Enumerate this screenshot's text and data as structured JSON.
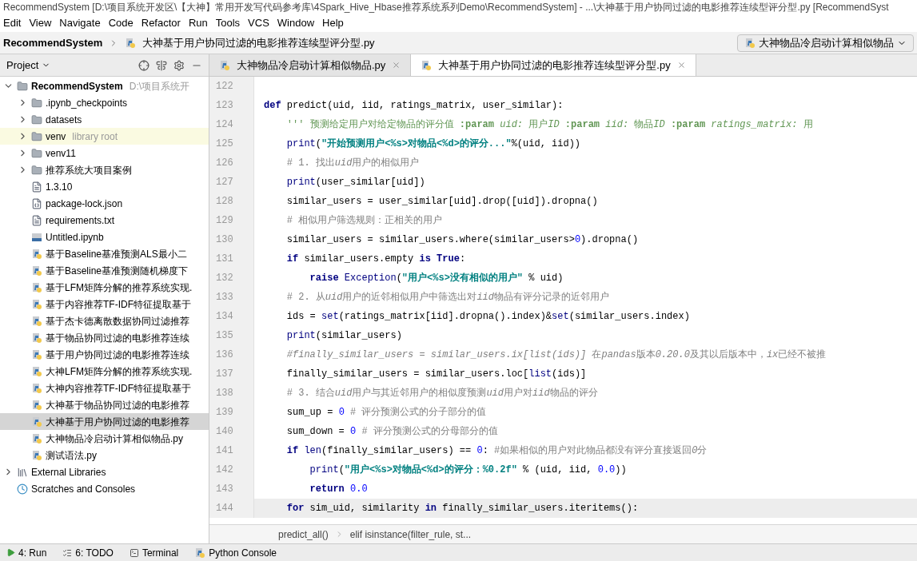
{
  "window": {
    "title": "RecommendSystem [D:\\项目系统开发区\\【大神】常用开发写代码参考库\\4Spark_Hive_Hbase推荐系统系列Demo\\RecommendSystem] - ...\\大神基于用户协同过滤的电影推荐连续型评分型.py [RecommendSyst"
  },
  "menu": [
    "Edit",
    "View",
    "Navigate",
    "Code",
    "Refactor",
    "Run",
    "Tools",
    "VCS",
    "Window",
    "Help"
  ],
  "navbar": {
    "project": "RecommendSystem",
    "file": "大神基于用户协同过滤的电影推荐连续型评分型.py",
    "run_config": "大神物品冷启动计算相似物品"
  },
  "project_panel": {
    "title": "Project",
    "tree": [
      {
        "label": "RecommendSystem",
        "hint": "D:\\项目系统开",
        "kind": "folder",
        "expanded": true,
        "selected": false,
        "children": [
          {
            "label": ".ipynb_checkpoints",
            "kind": "folder",
            "expanded": false,
            "selected": false
          },
          {
            "label": "datasets",
            "kind": "folder",
            "expanded": false,
            "selected": false
          },
          {
            "label": "venv",
            "hint": "library root",
            "kind": "folder",
            "expanded": false,
            "selected": false
          },
          {
            "label": "venv11",
            "kind": "folder",
            "expanded": false,
            "selected": false
          },
          {
            "label": "推荐系统大项目案例",
            "kind": "folder",
            "expanded": false,
            "selected": false
          },
          {
            "label": "1.3.10",
            "kind": "text",
            "selected": false
          },
          {
            "label": "package-lock.json",
            "kind": "json",
            "selected": false
          },
          {
            "label": "requirements.txt",
            "kind": "text",
            "selected": false
          },
          {
            "label": "Untitled.ipynb",
            "kind": "ipynb",
            "selected": false
          },
          {
            "label": "基于Baseline基准预测ALS最小二",
            "kind": "python",
            "selected": false
          },
          {
            "label": "基于Baseline基准预测随机梯度下",
            "kind": "python",
            "selected": false
          },
          {
            "label": "基于LFM矩阵分解的推荐系统实现.",
            "kind": "python",
            "selected": false
          },
          {
            "label": "基于内容推荐TF-IDF特征提取基于",
            "kind": "python",
            "selected": false
          },
          {
            "label": "基于杰卡德离散数据协同过滤推荐",
            "kind": "python",
            "selected": false
          },
          {
            "label": "基于物品协同过滤的电影推荐连续",
            "kind": "python",
            "selected": false
          },
          {
            "label": "基于用户协同过滤的电影推荐连续",
            "kind": "python",
            "selected": false
          },
          {
            "label": "大神LFM矩阵分解的推荐系统实现.",
            "kind": "python",
            "selected": false
          },
          {
            "label": "大神内容推荐TF-IDF特征提取基于",
            "kind": "python",
            "selected": false
          },
          {
            "label": "大神基于物品协同过滤的电影推荐",
            "kind": "python",
            "selected": false
          },
          {
            "label": "大神基于用户协同过滤的电影推荐",
            "kind": "python",
            "selected": true
          },
          {
            "label": "大神物品冷启动计算相似物品.py",
            "kind": "python",
            "selected": false
          },
          {
            "label": "测试语法.py",
            "kind": "python",
            "selected": false
          }
        ]
      },
      {
        "label": "External Libraries",
        "kind": "libraries",
        "expanded": false,
        "selected": false
      },
      {
        "label": "Scratches and Consoles",
        "kind": "scratches",
        "selected": false
      }
    ]
  },
  "tabs": [
    {
      "label": "大神物品冷启动计算相似物品.py",
      "selected": false
    },
    {
      "label": "大神基于用户协同过滤的电影推荐连续型评分型.py",
      "selected": true
    }
  ],
  "code": [
    {
      "number": "122",
      "current": false
    },
    {
      "number": "123",
      "current": false,
      "tokens": [
        {
          "kind": "kw",
          "text": "def "
        },
        {
          "kind": "plain",
          "text": "predict(uid, iid, ratings_matrix, user_similar):"
        }
      ]
    },
    {
      "number": "124",
      "current": false,
      "tokens": [
        {
          "kind": "doc",
          "text": "    ''' 预测给定用户对给定物品的评分值 "
        },
        {
          "kind": "docb",
          "text": ":param "
        },
        {
          "kind": "doci",
          "text": "uid: "
        },
        {
          "kind": "doc",
          "text": "用户"
        },
        {
          "kind": "doci",
          "text": "ID "
        },
        {
          "kind": "docb",
          "text": ":param "
        },
        {
          "kind": "doci",
          "text": "iid: "
        },
        {
          "kind": "doc",
          "text": "物品"
        },
        {
          "kind": "doci",
          "text": "ID "
        },
        {
          "kind": "docb",
          "text": ":param "
        },
        {
          "kind": "doci",
          "text": "ratings_matrix: "
        },
        {
          "kind": "doc",
          "text": "用"
        }
      ]
    },
    {
      "number": "125",
      "current": false,
      "tokens": [
        {
          "kind": "builtin",
          "text": "    print"
        },
        {
          "kind": "plain",
          "text": "("
        },
        {
          "kind": "str",
          "text": "\"开始预测用户<%s>对物品<%d>的评分...\""
        },
        {
          "kind": "plain",
          "text": "%(uid, iid))"
        }
      ]
    },
    {
      "number": "126",
      "current": false,
      "tokens": [
        {
          "kind": "cmt",
          "text": "    # 1. 找出"
        },
        {
          "kind": "cmti",
          "text": "uid"
        },
        {
          "kind": "cmt",
          "text": "用户的相似用户"
        }
      ]
    },
    {
      "number": "127",
      "current": false,
      "tokens": [
        {
          "kind": "builtin",
          "text": "    print"
        },
        {
          "kind": "plain",
          "text": "(user_similar[uid])"
        }
      ]
    },
    {
      "number": "128",
      "current": false,
      "tokens": [
        {
          "kind": "plain",
          "text": "    similar_users = user_similar[uid].drop([uid]).dropna()"
        }
      ]
    },
    {
      "number": "129",
      "current": false,
      "tokens": [
        {
          "kind": "cmt",
          "text": "    # 相似用户筛选规则：正相关的用户"
        }
      ]
    },
    {
      "number": "130",
      "current": false,
      "tokens": [
        {
          "kind": "plain",
          "text": "    similar_users = similar_users.where(similar_users>"
        },
        {
          "kind": "num",
          "text": "0"
        },
        {
          "kind": "plain",
          "text": ").dropna()"
        }
      ]
    },
    {
      "number": "131",
      "current": false,
      "tokens": [
        {
          "kind": "kw",
          "text": "    if "
        },
        {
          "kind": "plain",
          "text": "similar_users.empty "
        },
        {
          "kind": "kw",
          "text": "is True"
        },
        {
          "kind": "plain",
          "text": ":"
        }
      ]
    },
    {
      "number": "132",
      "current": false,
      "tokens": [
        {
          "kind": "kw",
          "text": "        raise "
        },
        {
          "kind": "builtin",
          "text": "Exception"
        },
        {
          "kind": "plain",
          "text": "("
        },
        {
          "kind": "str",
          "text": "\"用户<%s>没有相似的用户\""
        },
        {
          "kind": "plain",
          "text": " % uid)"
        }
      ]
    },
    {
      "number": "133",
      "current": false,
      "tokens": [
        {
          "kind": "cmt",
          "text": "    # 2. 从"
        },
        {
          "kind": "cmti",
          "text": "uid"
        },
        {
          "kind": "cmt",
          "text": "用户的近邻相似用户中筛选出对"
        },
        {
          "kind": "cmti",
          "text": "iid"
        },
        {
          "kind": "cmt",
          "text": "物品有评分记录的近邻用户"
        }
      ]
    },
    {
      "number": "134",
      "current": false,
      "tokens": [
        {
          "kind": "plain",
          "text": "    ids = "
        },
        {
          "kind": "builtin",
          "text": "set"
        },
        {
          "kind": "plain",
          "text": "(ratings_matrix[iid].dropna().index)&"
        },
        {
          "kind": "builtin",
          "text": "set"
        },
        {
          "kind": "plain",
          "text": "(similar_users.index)"
        }
      ]
    },
    {
      "number": "135",
      "current": false,
      "tokens": [
        {
          "kind": "builtin",
          "text": "    print"
        },
        {
          "kind": "plain",
          "text": "(similar_users)"
        }
      ]
    },
    {
      "number": "136",
      "current": false,
      "tokens": [
        {
          "kind": "cmti",
          "text": "    #finally_similar_users = similar_users.ix[list(ids)] "
        },
        {
          "kind": "cmt",
          "text": "在"
        },
        {
          "kind": "cmti",
          "text": "pandas"
        },
        {
          "kind": "cmt",
          "text": "版本"
        },
        {
          "kind": "cmti",
          "text": "0.20.0"
        },
        {
          "kind": "cmt",
          "text": "及其以后版本中，"
        },
        {
          "kind": "cmti",
          "text": "ix"
        },
        {
          "kind": "cmt",
          "text": "已经不被推"
        }
      ]
    },
    {
      "number": "137",
      "current": false,
      "tokens": [
        {
          "kind": "plain",
          "text": "    finally_similar_users = similar_users.loc["
        },
        {
          "kind": "builtin",
          "text": "list"
        },
        {
          "kind": "plain",
          "text": "(ids)]"
        }
      ]
    },
    {
      "number": "138",
      "current": false,
      "tokens": [
        {
          "kind": "cmt",
          "text": "    # 3. 结合"
        },
        {
          "kind": "cmti",
          "text": "uid"
        },
        {
          "kind": "cmt",
          "text": "用户与其近邻用户的相似度预测"
        },
        {
          "kind": "cmti",
          "text": "uid"
        },
        {
          "kind": "cmt",
          "text": "用户对"
        },
        {
          "kind": "cmti",
          "text": "iid"
        },
        {
          "kind": "cmt",
          "text": "物品的评分"
        }
      ]
    },
    {
      "number": "139",
      "current": false,
      "tokens": [
        {
          "kind": "plain",
          "text": "    sum_up = "
        },
        {
          "kind": "num",
          "text": "0"
        },
        {
          "kind": "cmt",
          "text": " # 评分预测公式的分子部分的值"
        }
      ]
    },
    {
      "number": "140",
      "current": false,
      "tokens": [
        {
          "kind": "plain",
          "text": "    sum_down = "
        },
        {
          "kind": "num",
          "text": "0"
        },
        {
          "kind": "cmt",
          "text": " # 评分预测公式的分母部分的值"
        }
      ]
    },
    {
      "number": "141",
      "current": false,
      "tokens": [
        {
          "kind": "kw",
          "text": "    if "
        },
        {
          "kind": "builtin",
          "text": "len"
        },
        {
          "kind": "plain",
          "text": "(finally_similar_users) == "
        },
        {
          "kind": "num",
          "text": "0"
        },
        {
          "kind": "plain",
          "text": ": "
        },
        {
          "kind": "cmt",
          "text": "#如果相似的用户对此物品都没有评分直接返回"
        },
        {
          "kind": "cmti",
          "text": "0"
        },
        {
          "kind": "cmt",
          "text": "分"
        }
      ]
    },
    {
      "number": "142",
      "current": false,
      "tokens": [
        {
          "kind": "builtin",
          "text": "        print"
        },
        {
          "kind": "plain",
          "text": "("
        },
        {
          "kind": "str",
          "text": "\"用户<%s>对物品<%d>的评分：%0.2f\""
        },
        {
          "kind": "plain",
          "text": " % (uid, iid, "
        },
        {
          "kind": "num",
          "text": "0.0"
        },
        {
          "kind": "plain",
          "text": "))"
        }
      ]
    },
    {
      "number": "143",
      "current": false,
      "tokens": [
        {
          "kind": "kw",
          "text": "        return "
        },
        {
          "kind": "num",
          "text": "0.0"
        }
      ]
    },
    {
      "number": "144",
      "current": true,
      "tokens": [
        {
          "kind": "kw",
          "text": "    for "
        },
        {
          "kind": "plain",
          "text": "sim_uid, similarity "
        },
        {
          "kind": "kw",
          "text": "in "
        },
        {
          "kind": "plain",
          "text": "finally_similar_users.iteritems():"
        }
      ]
    }
  ],
  "breadcrumb": [
    "predict_all()",
    "elif isinstance(filter_rule, st..."
  ],
  "tool_windows": [
    {
      "label": "4: Run",
      "kind": "run"
    },
    {
      "label": "6: TODO",
      "kind": "todo"
    },
    {
      "label": "Terminal",
      "kind": "terminal"
    },
    {
      "label": "Python Console",
      "kind": "console"
    }
  ]
}
